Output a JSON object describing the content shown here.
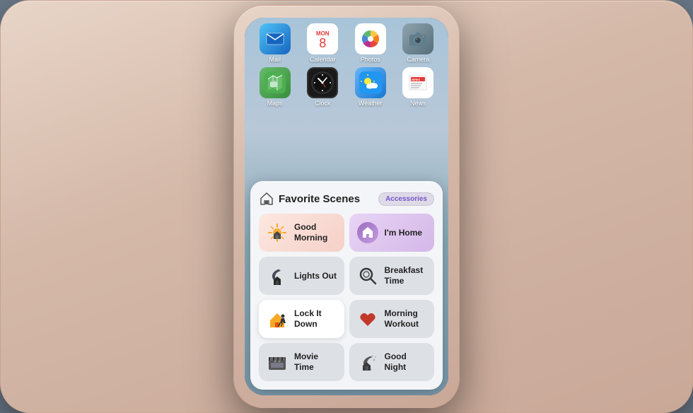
{
  "phone": {
    "apps": [
      {
        "id": "mail",
        "label": "Mail",
        "icon_type": "mail",
        "emoji": "✉️"
      },
      {
        "id": "calendar",
        "label": "Calendar",
        "icon_type": "calendar",
        "emoji": "📅"
      },
      {
        "id": "photos",
        "label": "Photos",
        "icon_type": "photos",
        "emoji": "🌸"
      },
      {
        "id": "camera",
        "label": "Camera",
        "icon_type": "camera",
        "emoji": "📷"
      },
      {
        "id": "maps",
        "label": "Maps",
        "icon_type": "maps",
        "emoji": "🗺️"
      },
      {
        "id": "clock",
        "label": "Clock",
        "icon_type": "clock",
        "emoji": "🕐"
      },
      {
        "id": "weather",
        "label": "Weather",
        "icon_type": "weather",
        "emoji": "⛅"
      },
      {
        "id": "news",
        "label": "News",
        "icon_type": "news",
        "emoji": "📰"
      }
    ]
  },
  "scenes_card": {
    "title": "Favorite Scenes",
    "accessories_label": "Accessories",
    "scenes": [
      {
        "id": "good-morning",
        "label": "Good Morning",
        "tile_class": "tile-good-morning",
        "icon": "☀️"
      },
      {
        "id": "im-home",
        "label": "I'm Home",
        "tile_class": "tile-im-home",
        "icon": "🏠"
      },
      {
        "id": "lights-out",
        "label": "Lights Out",
        "tile_class": "tile-lights-out",
        "icon": "🌙"
      },
      {
        "id": "breakfast-time",
        "label": "Breakfast Time",
        "tile_class": "tile-breakfast-time",
        "icon": "🔍"
      },
      {
        "id": "lock-it-down",
        "label": "Lock It Down",
        "tile_class": "tile-lock-it-down",
        "icon": "🏃"
      },
      {
        "id": "morning-workout",
        "label": "Morning Workout",
        "tile_class": "tile-morning-workout",
        "icon": "❤️"
      },
      {
        "id": "movie-time",
        "label": "Movie Time",
        "tile_class": "tile-movie-time",
        "icon": "🎬"
      },
      {
        "id": "good-night",
        "label": "Good Night",
        "tile_class": "tile-good-night",
        "icon": "🌙"
      }
    ]
  }
}
